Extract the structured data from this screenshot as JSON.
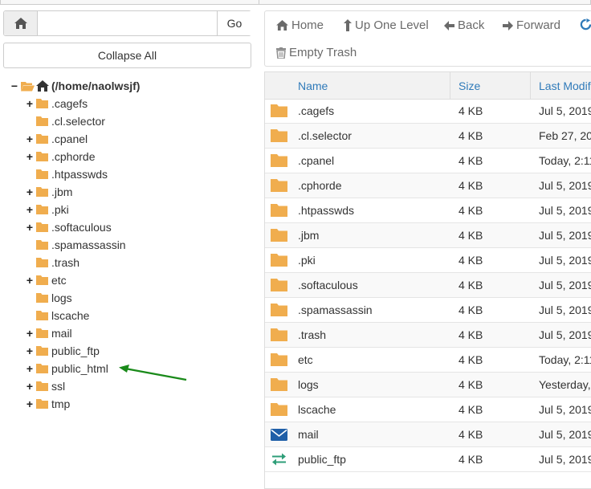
{
  "path_bar": {
    "input_value": "",
    "go_label": "Go"
  },
  "collapse_label": "Collapse All",
  "tree": {
    "root_label": "(/home/naolwsjf)",
    "items": [
      {
        "label": ".cagefs",
        "expandable": true
      },
      {
        "label": ".cl.selector",
        "expandable": false
      },
      {
        "label": ".cpanel",
        "expandable": true
      },
      {
        "label": ".cphorde",
        "expandable": true
      },
      {
        "label": ".htpasswds",
        "expandable": false
      },
      {
        "label": ".jbm",
        "expandable": true
      },
      {
        "label": ".pki",
        "expandable": true
      },
      {
        "label": ".softaculous",
        "expandable": true
      },
      {
        "label": ".spamassassin",
        "expandable": false
      },
      {
        "label": ".trash",
        "expandable": false
      },
      {
        "label": "etc",
        "expandable": true
      },
      {
        "label": "logs",
        "expandable": false
      },
      {
        "label": "lscache",
        "expandable": false
      },
      {
        "label": "mail",
        "expandable": true
      },
      {
        "label": "public_ftp",
        "expandable": true
      },
      {
        "label": "public_html",
        "expandable": true
      },
      {
        "label": "ssl",
        "expandable": true
      },
      {
        "label": "tmp",
        "expandable": true
      }
    ]
  },
  "toolbar": {
    "home": "Home",
    "up_one_level": "Up One Level",
    "back": "Back",
    "forward": "Forward",
    "empty_trash": "Empty Trash"
  },
  "table": {
    "headers": {
      "name": "Name",
      "size": "Size",
      "modified": "Last Modifi"
    },
    "rows": [
      {
        "icon": "folder-icon",
        "name": ".cagefs",
        "size": "4 KB",
        "modified": "Jul 5, 2019"
      },
      {
        "icon": "folder-icon",
        "name": ".cl.selector",
        "size": "4 KB",
        "modified": "Feb 27, 20"
      },
      {
        "icon": "folder-icon",
        "name": ".cpanel",
        "size": "4 KB",
        "modified": "Today, 2:11"
      },
      {
        "icon": "folder-icon",
        "name": ".cphorde",
        "size": "4 KB",
        "modified": "Jul 5, 2019"
      },
      {
        "icon": "folder-icon",
        "name": ".htpasswds",
        "size": "4 KB",
        "modified": "Jul 5, 2019"
      },
      {
        "icon": "folder-icon",
        "name": ".jbm",
        "size": "4 KB",
        "modified": "Jul 5, 2019"
      },
      {
        "icon": "folder-icon",
        "name": ".pki",
        "size": "4 KB",
        "modified": "Jul 5, 2019"
      },
      {
        "icon": "folder-icon",
        "name": ".softaculous",
        "size": "4 KB",
        "modified": "Jul 5, 2019"
      },
      {
        "icon": "folder-icon",
        "name": ".spamassassin",
        "size": "4 KB",
        "modified": "Jul 5, 2019"
      },
      {
        "icon": "folder-icon",
        "name": ".trash",
        "size": "4 KB",
        "modified": "Jul 5, 2019"
      },
      {
        "icon": "folder-icon",
        "name": "etc",
        "size": "4 KB",
        "modified": "Today, 2:11"
      },
      {
        "icon": "folder-icon",
        "name": "logs",
        "size": "4 KB",
        "modified": "Yesterday,"
      },
      {
        "icon": "folder-icon",
        "name": "lscache",
        "size": "4 KB",
        "modified": "Jul 5, 2019"
      },
      {
        "icon": "envelope-icon",
        "name": "mail",
        "size": "4 KB",
        "modified": "Jul 5, 2019"
      },
      {
        "icon": "transfer-arrows-icon",
        "name": "public_ftp",
        "size": "4 KB",
        "modified": "Jul 5, 2019"
      }
    ]
  },
  "colors": {
    "folder": "#f0ad4e",
    "link": "#2f7ab9",
    "mail_icon": "#1f5fa8",
    "ftp_icon": "#2e9e78",
    "annotation_arrow": "#1a8a1a"
  }
}
